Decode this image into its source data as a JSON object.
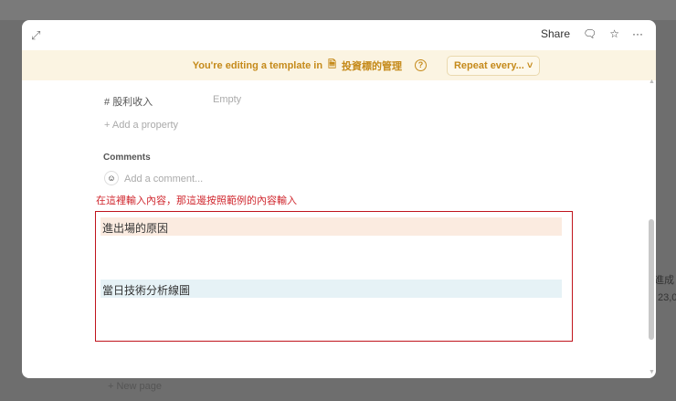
{
  "modal": {
    "share_label": "Share"
  },
  "banner": {
    "text": "You're editing a template in",
    "page_name": "投資標的管理",
    "repeat_label": "Repeat every..."
  },
  "properties": [
    {
      "icon": "#",
      "name": "股利收入",
      "value": "Empty"
    }
  ],
  "add_property_label": "Add a property",
  "comments": {
    "heading": "Comments",
    "placeholder": "Add a comment..."
  },
  "annotation": {
    "hint": "在這裡輸入內容，那這邊按照範例的內容輸入"
  },
  "blocks": [
    {
      "text": "進出場的原因"
    },
    {
      "text": "當日技術分析線圖"
    }
  ],
  "background": {
    "new_page": "+  New page",
    "side_label": "進成",
    "side_value": "23,0"
  },
  "colors": {
    "accent": "#c58a1a",
    "annotation": "#c0141c"
  }
}
